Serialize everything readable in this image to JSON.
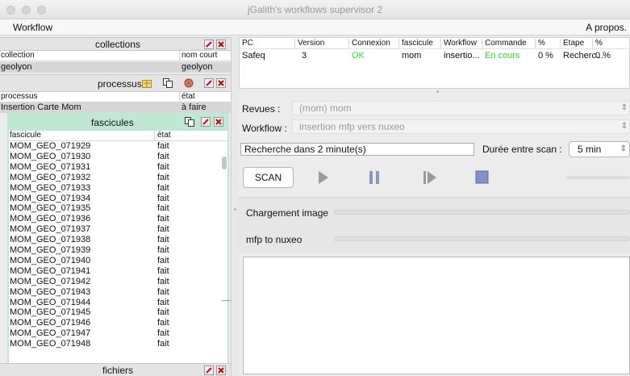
{
  "window": {
    "title": "jGalith's workflows supervisor 2"
  },
  "menubar": {
    "workflow": "Workflow",
    "about": "A propos."
  },
  "collections": {
    "title": "collections",
    "columns": [
      "collection",
      "nom court"
    ],
    "rows": [
      [
        "geolyon",
        "geolyon"
      ]
    ]
  },
  "processus": {
    "title": "processus",
    "columns": [
      "processus",
      "état"
    ],
    "rows": [
      [
        "Insertion Carte Mom",
        "à faire"
      ]
    ]
  },
  "fascicules": {
    "title": "fascicules",
    "columns": [
      "fascicule",
      "état"
    ],
    "rows": [
      [
        "MOM_GEO_071929",
        "fait"
      ],
      [
        "MOM_GEO_071930",
        "fait"
      ],
      [
        "MOM_GEO_071931",
        "fait"
      ],
      [
        "MOM_GEO_071932",
        "fait"
      ],
      [
        "MOM_GEO_071933",
        "fait"
      ],
      [
        "MOM_GEO_071934",
        "fait"
      ],
      [
        "MOM_GEO_071935",
        "fait"
      ],
      [
        "MOM_GEO_071936",
        "fait"
      ],
      [
        "MOM_GEO_071937",
        "fait"
      ],
      [
        "MOM_GEO_071938",
        "fait"
      ],
      [
        "MOM_GEO_071939",
        "fait"
      ],
      [
        "MOM_GEO_071940",
        "fait"
      ],
      [
        "MOM_GEO_071941",
        "fait"
      ],
      [
        "MOM_GEO_071942",
        "fait"
      ],
      [
        "MOM_GEO_071943",
        "fait"
      ],
      [
        "MOM_GEO_071944",
        "fait"
      ],
      [
        "MOM_GEO_071945",
        "fait"
      ],
      [
        "MOM_GEO_071946",
        "fait"
      ],
      [
        "MOM_GEO_071947",
        "fait"
      ],
      [
        "MOM_GEO_071948",
        "fait"
      ]
    ]
  },
  "fichiers": {
    "title": "fichiers"
  },
  "pc_table": {
    "columns": [
      "PC",
      "Version",
      "Connexion",
      "fascicule",
      "Workflow",
      "Commande",
      "%",
      "Etape",
      "%"
    ],
    "row": [
      "Safeq",
      "3",
      "OK",
      "mom",
      "insertio...",
      "En cours",
      "0 %",
      "Recherc...",
      "0 %"
    ]
  },
  "controls": {
    "revues_label": "Revues :",
    "revues_value": "(mom) mom",
    "workflow_label": "Workflow :",
    "workflow_value": "insertion mfp vers nuxeo",
    "search_status": "Recherche dans 2 minute(s)",
    "interval_label": "Durée entre scan :",
    "interval_value": "5 min",
    "scan_button": "SCAN"
  },
  "progress": {
    "items": [
      {
        "label": "Chargement image",
        "value": 0
      },
      {
        "label": "mfp to nuxeo",
        "value": 0
      }
    ]
  },
  "colors": {
    "fascicules_header": "#bfe7d4",
    "ok_green": "#2ee02e",
    "stop_blue": "#7f93c9"
  }
}
